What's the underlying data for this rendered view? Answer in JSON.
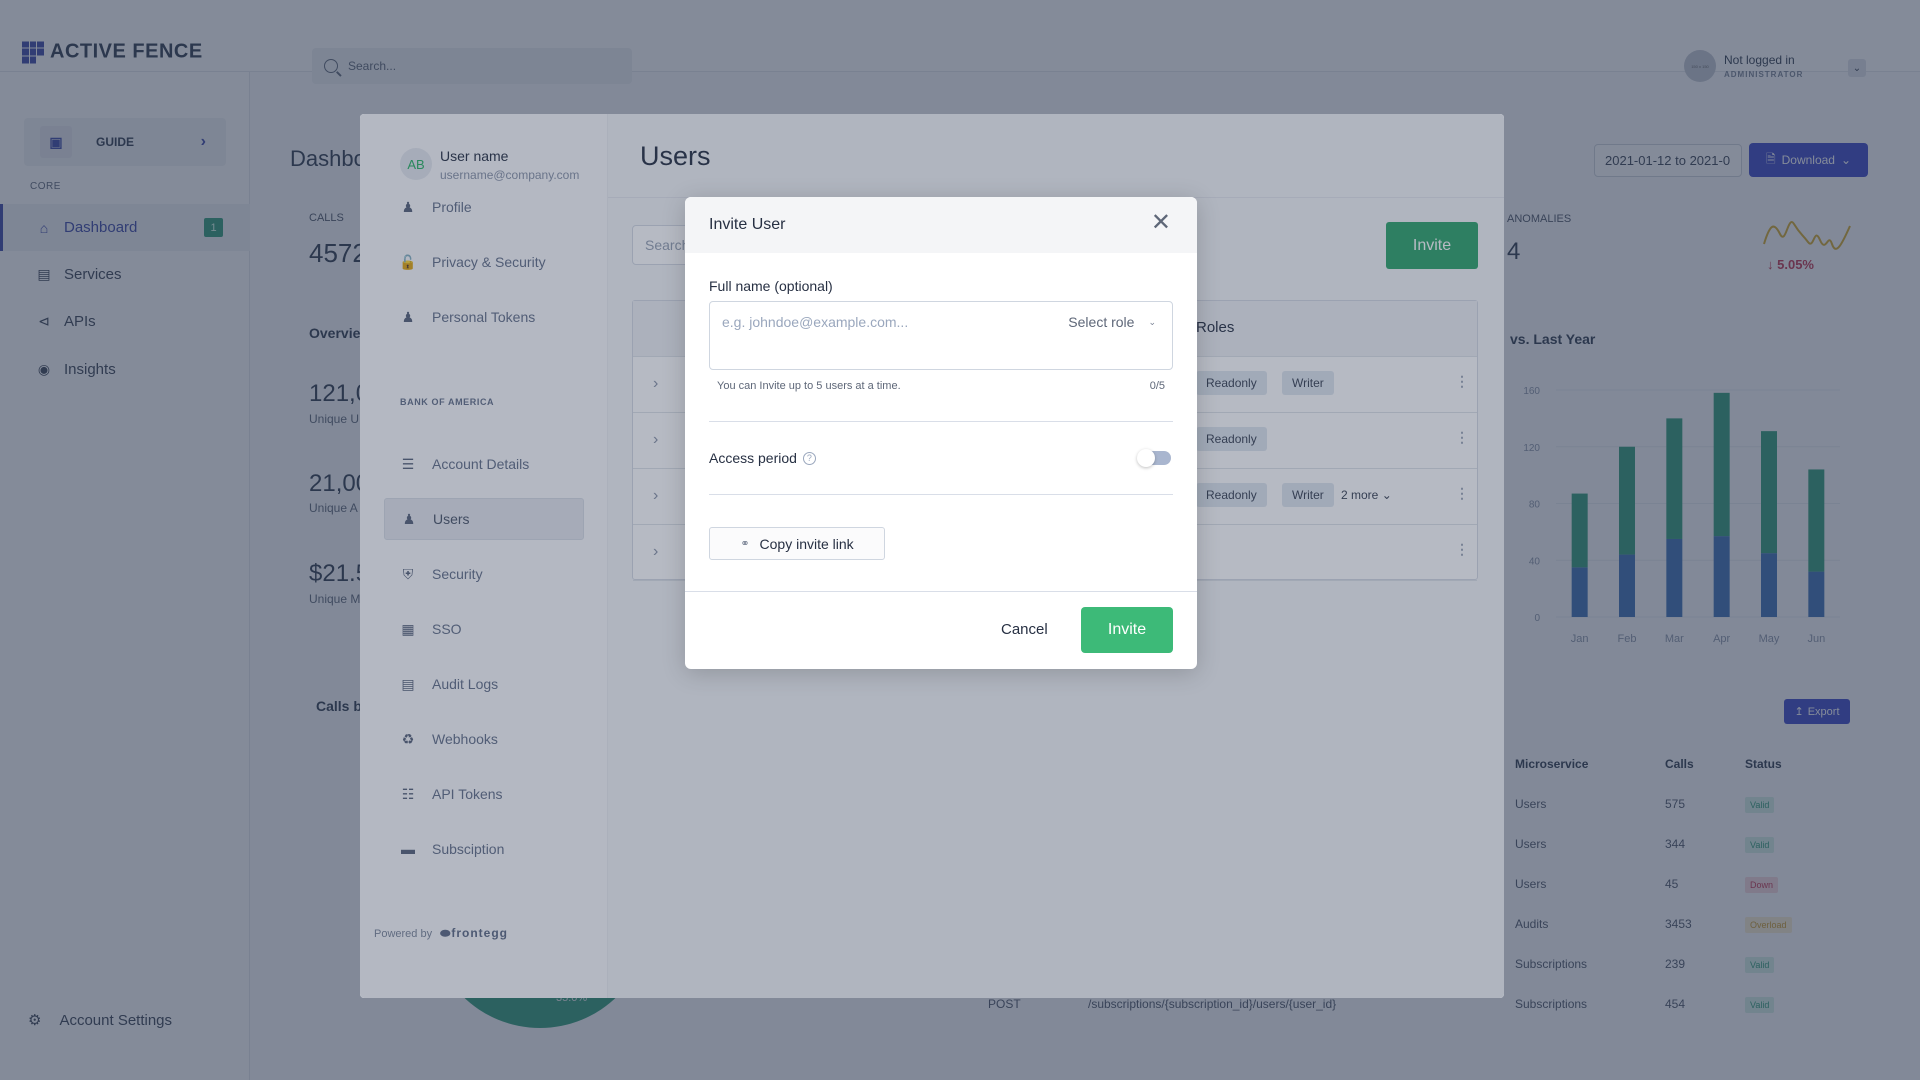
{
  "app": {
    "brand": "ACTIVE FENCE",
    "search_placeholder": "Search...",
    "user": {
      "avatar_text": "150 x 150",
      "name": "Not logged in",
      "role": "ADMINISTRATOR"
    }
  },
  "sidebar": {
    "guide_label": "GUIDE",
    "section": "CORE",
    "items": [
      {
        "label": "Dashboard",
        "badge": "1",
        "active": true
      },
      {
        "label": "Services"
      },
      {
        "label": "APIs"
      },
      {
        "label": "Insights"
      }
    ],
    "account_settings": "Account Settings"
  },
  "dashboard": {
    "title": "Dashboard",
    "calls_label": "CALLS",
    "calls_value": "4572",
    "overview_title": "Overview",
    "overview": [
      {
        "value": "121,0",
        "label": "Unique U"
      },
      {
        "value": "21,00",
        "label": "Unique A"
      },
      {
        "value": "$21.5",
        "label": "Unique M"
      }
    ],
    "calls_by_title": "Calls b",
    "pie_label": "35.0%",
    "date_range": "2021-01-12 to 2021-0",
    "download_label": "Download",
    "anomalies_label": "ANOMALIES",
    "anomalies_value": "4",
    "anomalies_delta": "5.05%",
    "vs_title": "vs. Last Year",
    "export_label": "Export",
    "table": {
      "headers": [
        "Microservice",
        "Calls",
        "Status"
      ],
      "rows": [
        {
          "service": "Users",
          "calls": "575",
          "status": "Valid"
        },
        {
          "service": "Users",
          "calls": "344",
          "status": "Valid"
        },
        {
          "service": "Users",
          "calls": "45",
          "status": "Down"
        },
        {
          "service": "Audits",
          "calls": "3453",
          "status": "Overload"
        },
        {
          "service": "Subscriptions",
          "calls": "239",
          "status": "Valid"
        },
        {
          "service": "Subscriptions",
          "calls": "454",
          "status": "Valid"
        }
      ],
      "post_row": {
        "method": "POST",
        "path": "/subscriptions/{subscription_id}/users/{user_id}"
      }
    }
  },
  "chart_data": {
    "type": "bar",
    "title": "vs. Last Year",
    "categories": [
      "Jan",
      "Feb",
      "Mar",
      "Apr",
      "May",
      "Jun"
    ],
    "series": [
      {
        "name": "blue",
        "values": [
          35,
          44,
          55,
          57,
          45,
          32
        ],
        "color": "#3b6fb6"
      },
      {
        "name": "green",
        "values": [
          52,
          76,
          85,
          101,
          86,
          72
        ],
        "color": "#2f9b78"
      }
    ],
    "stacked": true,
    "yticks": [
      0,
      40,
      80,
      120,
      160
    ],
    "ylim": [
      0,
      160
    ]
  },
  "portal": {
    "user": {
      "initials": "AB",
      "name": "User name",
      "email": "username@company.com"
    },
    "personal_items": [
      {
        "label": "Profile",
        "icon": "person-icon"
      },
      {
        "label": "Privacy & Security",
        "icon": "lock-icon"
      },
      {
        "label": "Personal Tokens",
        "icon": "person-key-icon"
      }
    ],
    "section": "BANK OF AMERICA",
    "account_items": [
      {
        "label": "Account Details",
        "icon": "sliders-icon"
      },
      {
        "label": "Users",
        "icon": "users-icon",
        "active": true
      },
      {
        "label": "Security",
        "icon": "shield-icon"
      },
      {
        "label": "SSO",
        "icon": "sso-icon"
      },
      {
        "label": "Audit Logs",
        "icon": "document-icon"
      },
      {
        "label": "Webhooks",
        "icon": "webhook-icon"
      },
      {
        "label": "API Tokens",
        "icon": "hierarchy-icon"
      },
      {
        "label": "Subsciption",
        "icon": "credit-card-icon"
      }
    ],
    "powered_by": "Powered by",
    "powered_brand": "frontegg",
    "page_title": "Users",
    "search_placeholder": "Search",
    "invite_label": "Invite",
    "roles_header": "Roles",
    "rows": [
      {
        "roles": [
          "Readonly",
          "Writer"
        ]
      },
      {
        "roles": [
          "Readonly"
        ]
      },
      {
        "roles": [
          "Readonly",
          "Writer"
        ],
        "more": "2 more"
      },
      {
        "roles": []
      }
    ]
  },
  "modal": {
    "title": "Invite User",
    "name_label": "Full name (optional)",
    "email_placeholder": "e.g. johndoe@example.com...",
    "email_value": "",
    "role_label": "Select role",
    "hint": "You can Invite up to 5 users at a time.",
    "count": "0/5",
    "access_label": "Access period",
    "access_enabled": false,
    "copy_link_label": "Copy invite link",
    "cancel_label": "Cancel",
    "invite_label": "Invite"
  }
}
